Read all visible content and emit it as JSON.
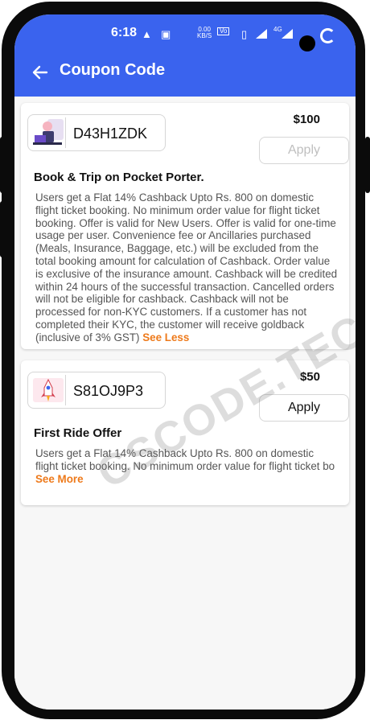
{
  "status_bar": {
    "time": "6:18",
    "speed_value": "0.00",
    "speed_unit": "KB/S",
    "network_label": "4G"
  },
  "header": {
    "title": "Coupon Code",
    "background_color": "#3a63ee"
  },
  "coupons": [
    {
      "code": "D43H1ZDK",
      "price": "$100",
      "apply_label": "Apply",
      "apply_enabled": false,
      "title": "Book & Trip on Pocket Porter.",
      "description": "Users get a Flat 14% Cashback Upto Rs. 800 on domestic flight ticket booking. No minimum order value for flight ticket booking. Offer is valid for New Users. Offer is valid for one-time usage per user. Convenience fee or Ancillaries purchased (Meals, Insurance, Baggage, etc.) will be excluded from the total booking amount for calculation of Cashback. Order value is exclusive of the insurance amount. Cashback will be credited within 24 hours of the successful transaction. Cancelled orders will not be eligible for cashback. Cashback will not be processed for non-KYC customers. If a customer has not completed their KYC, the customer will receive goldback (inclusive of 3% GST)",
      "toggle_label": "See Less"
    },
    {
      "code": "S81OJ9P3",
      "price": "$50",
      "apply_label": "Apply",
      "apply_enabled": true,
      "title": "First Ride Offer",
      "description": "Users get a Flat 14% Cashback Upto Rs. 800 on domestic flight ticket booking. No minimum order value for flight ticket bo",
      "toggle_label": "See More"
    }
  ],
  "watermark": "CSCODE.TECH",
  "accent_color": "#ee7a1b"
}
